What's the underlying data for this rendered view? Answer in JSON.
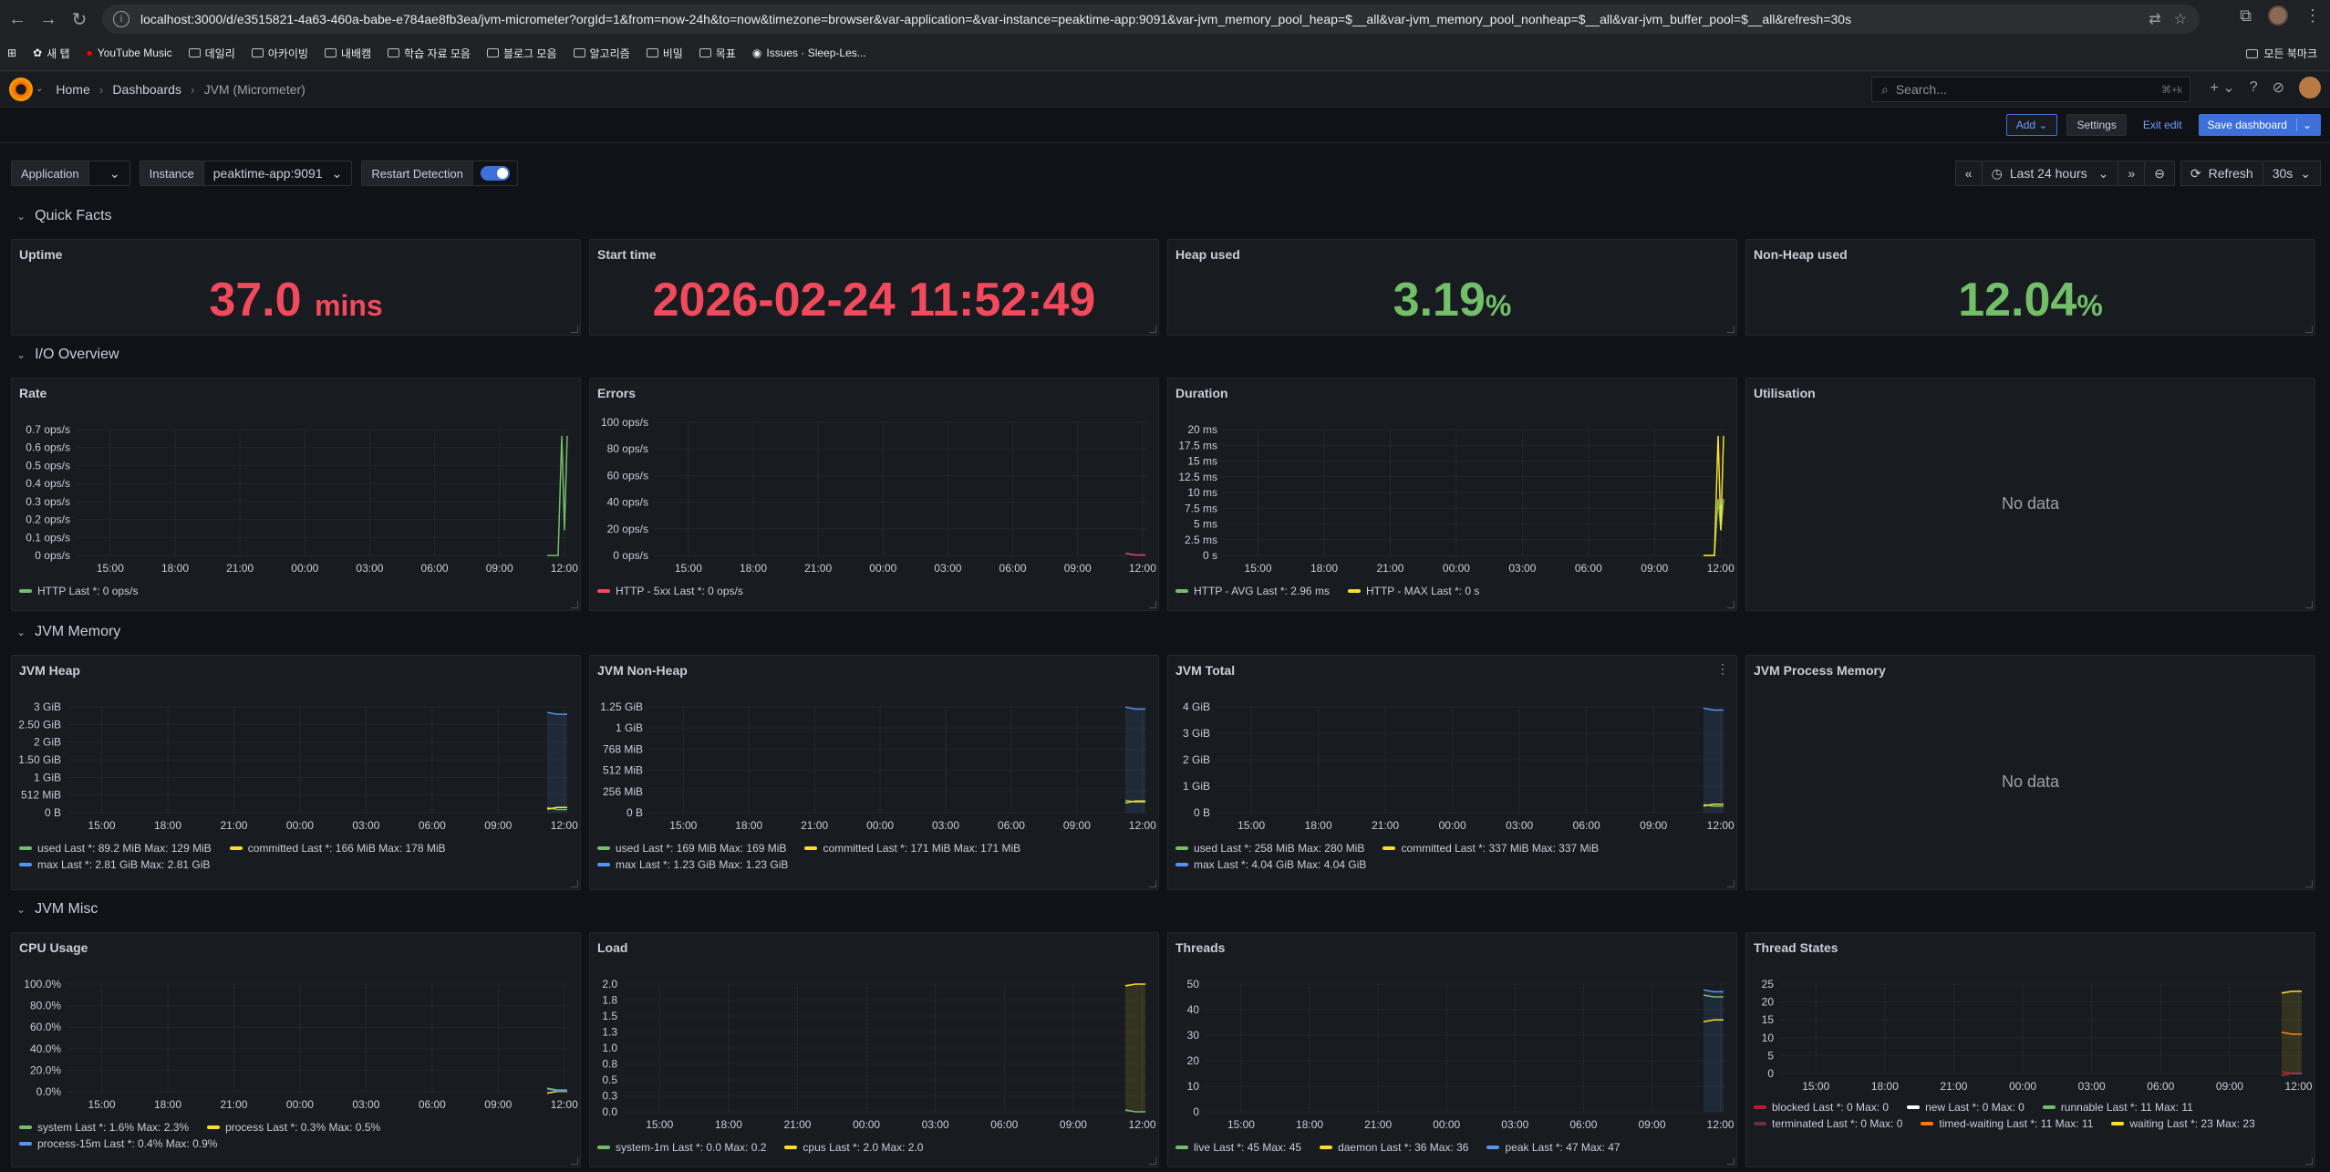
{
  "browser": {
    "url": "localhost:3000/d/e3515821-4a63-460a-babe-e784ae8fb3ea/jvm-micrometer?orgId=1&from=now-24h&to=now&timezone=browser&var-application=&var-instance=peaktime-app:9091&var-jvm_memory_pool_heap=$__all&var-jvm_memory_pool_nonheap=$__all&var-jvm_buffer_pool=$__all&refresh=30s",
    "bookmarks": [
      "새 탭",
      "YouTube Music",
      "데일리",
      "아카이빙",
      "내배캠",
      "학습 자료 모음",
      "블로그 모음",
      "알고리즘",
      "비밀",
      "목표",
      "Issues · Sleep-Les..."
    ],
    "all_bookmarks": "모든 북마크"
  },
  "header": {
    "breadcrumb": [
      "Home",
      "Dashboards",
      "JVM (Micrometer)"
    ],
    "search_placeholder": "Search...",
    "search_shortcut": "⌘+k"
  },
  "toolbar": {
    "add": "Add",
    "settings": "Settings",
    "exit_edit": "Exit edit",
    "save": "Save dashboard"
  },
  "variables": {
    "application_label": "Application",
    "application_value": "",
    "instance_label": "Instance",
    "instance_value": "peaktime-app:9091",
    "restart_label": "Restart Detection"
  },
  "time": {
    "range": "Last 24 hours",
    "refresh": "Refresh",
    "interval": "30s"
  },
  "rows": {
    "quick_facts": "Quick Facts",
    "io": "I/O Overview",
    "jvm_memory": "JVM Memory",
    "jvm_misc": "JVM Misc"
  },
  "colors": {
    "red": "#f2495c",
    "green": "#73bf69",
    "yellow": "#fade2a",
    "blue": "#5794f2",
    "orange": "#ff780a",
    "darkred": "#c4162a",
    "white": "#ffffff",
    "darkgray": "#6e2f3a"
  },
  "quick_facts": [
    {
      "title": "Uptime",
      "value": "37.0",
      "unit": "mins",
      "color": "#f2495c"
    },
    {
      "title": "Start time",
      "value": "2026-02-24 11:52:49",
      "unit": "",
      "color": "#f2495c"
    },
    {
      "title": "Heap used",
      "value": "3.19",
      "unit": "%",
      "color": "#73bf69"
    },
    {
      "title": "Non-Heap used",
      "value": "12.04",
      "unit": "%",
      "color": "#73bf69"
    }
  ],
  "no_data": "No data",
  "x_ticks": [
    "15:00",
    "18:00",
    "21:00",
    "00:00",
    "03:00",
    "06:00",
    "09:00",
    "12:00"
  ],
  "panels": {
    "rate": {
      "title": "Rate",
      "yticks": [
        "0 ops/s",
        "0.1 ops/s",
        "0.2 ops/s",
        "0.3 ops/s",
        "0.4 ops/s",
        "0.5 ops/s",
        "0.6 ops/s",
        "0.7 ops/s"
      ],
      "legend": [
        {
          "color": "#73bf69",
          "text": "HTTP  Last *: 0 ops/s"
        }
      ]
    },
    "errors": {
      "title": "Errors",
      "yticks": [
        "0 ops/s",
        "20 ops/s",
        "40 ops/s",
        "60 ops/s",
        "80 ops/s",
        "100 ops/s"
      ],
      "legend": [
        {
          "color": "#f2495c",
          "text": "HTTP - 5xx  Last *: 0 ops/s"
        }
      ]
    },
    "duration": {
      "title": "Duration",
      "yticks": [
        "0 s",
        "2.5 ms",
        "5 ms",
        "7.5 ms",
        "10 ms",
        "12.5 ms",
        "15 ms",
        "17.5 ms",
        "20 ms"
      ],
      "legend": [
        {
          "color": "#73bf69",
          "text": "HTTP - AVG  Last *: 2.96 ms"
        },
        {
          "color": "#fade2a",
          "text": "HTTP - MAX  Last *: 0 s"
        }
      ]
    },
    "utilisation": {
      "title": "Utilisation"
    },
    "heap": {
      "title": "JVM Heap",
      "yticks": [
        "0 B",
        "512 MiB",
        "1 GiB",
        "1.50 GiB",
        "2 GiB",
        "2.50 GiB",
        "3 GiB"
      ],
      "legend": [
        {
          "color": "#73bf69",
          "text": "used  Last *: 89.2 MiB  Max: 129 MiB"
        },
        {
          "color": "#fade2a",
          "text": "committed  Last *: 166 MiB  Max: 178 MiB"
        },
        {
          "color": "#5794f2",
          "text": "max  Last *: 2.81 GiB  Max: 2.81 GiB"
        }
      ]
    },
    "nonheap": {
      "title": "JVM Non-Heap",
      "yticks": [
        "0 B",
        "256 MiB",
        "512 MiB",
        "768 MiB",
        "1 GiB",
        "1.25 GiB"
      ],
      "legend": [
        {
          "color": "#73bf69",
          "text": "used  Last *: 169 MiB  Max: 169 MiB"
        },
        {
          "color": "#fade2a",
          "text": "committed  Last *: 171 MiB  Max: 171 MiB"
        },
        {
          "color": "#5794f2",
          "text": "max  Last *: 1.23 GiB  Max: 1.23 GiB"
        }
      ]
    },
    "total": {
      "title": "JVM Total",
      "yticks": [
        "0 B",
        "1 GiB",
        "2 GiB",
        "3 GiB",
        "4 GiB"
      ],
      "legend": [
        {
          "color": "#73bf69",
          "text": "used  Last *: 258 MiB  Max: 280 MiB"
        },
        {
          "color": "#fade2a",
          "text": "committed  Last *: 337 MiB  Max: 337 MiB"
        },
        {
          "color": "#5794f2",
          "text": "max  Last *: 4.04 GiB  Max: 4.04 GiB"
        }
      ]
    },
    "process_memory": {
      "title": "JVM Process Memory"
    },
    "cpu": {
      "title": "CPU Usage",
      "yticks": [
        "0.0%",
        "20.0%",
        "40.0%",
        "60.0%",
        "80.0%",
        "100.0%"
      ],
      "legend": [
        {
          "color": "#73bf69",
          "text": "system  Last *: 1.6%  Max: 2.3%"
        },
        {
          "color": "#fade2a",
          "text": "process  Last *: 0.3%  Max: 0.5%"
        },
        {
          "color": "#5794f2",
          "text": "process-15m  Last *: 0.4%  Max: 0.9%"
        }
      ]
    },
    "load": {
      "title": "Load",
      "yticks": [
        "0.0",
        "0.3",
        "0.5",
        "0.8",
        "1.0",
        "1.3",
        "1.5",
        "1.8",
        "2.0"
      ],
      "legend": [
        {
          "color": "#73bf69",
          "text": "system-1m  Last *: 0.0  Max: 0.2"
        },
        {
          "color": "#fade2a",
          "text": "cpus  Last *: 2.0  Max: 2.0"
        }
      ]
    },
    "threads": {
      "title": "Threads",
      "yticks": [
        "0",
        "10",
        "20",
        "30",
        "40",
        "50"
      ],
      "legend": [
        {
          "color": "#73bf69",
          "text": "live  Last *: 45  Max: 45"
        },
        {
          "color": "#fade2a",
          "text": "daemon  Last *: 36  Max: 36"
        },
        {
          "color": "#5794f2",
          "text": "peak  Last *: 47  Max: 47"
        }
      ]
    },
    "thread_states": {
      "title": "Thread States",
      "yticks": [
        "0",
        "5",
        "10",
        "15",
        "20",
        "25"
      ],
      "legend": [
        {
          "color": "#c4162a",
          "text": "blocked  Last *: 0  Max: 0"
        },
        {
          "color": "#ffffff",
          "text": "new  Last *: 0  Max: 0"
        },
        {
          "color": "#73bf69",
          "text": "runnable  Last *: 11  Max: 11"
        },
        {
          "color": "#6e2f3a",
          "text": "terminated  Last *: 0  Max: 0"
        },
        {
          "color": "#ff780a",
          "text": "timed-waiting  Last *: 11  Max: 11"
        },
        {
          "color": "#fade2a",
          "text": "waiting  Last *: 23  Max: 23"
        }
      ]
    }
  }
}
